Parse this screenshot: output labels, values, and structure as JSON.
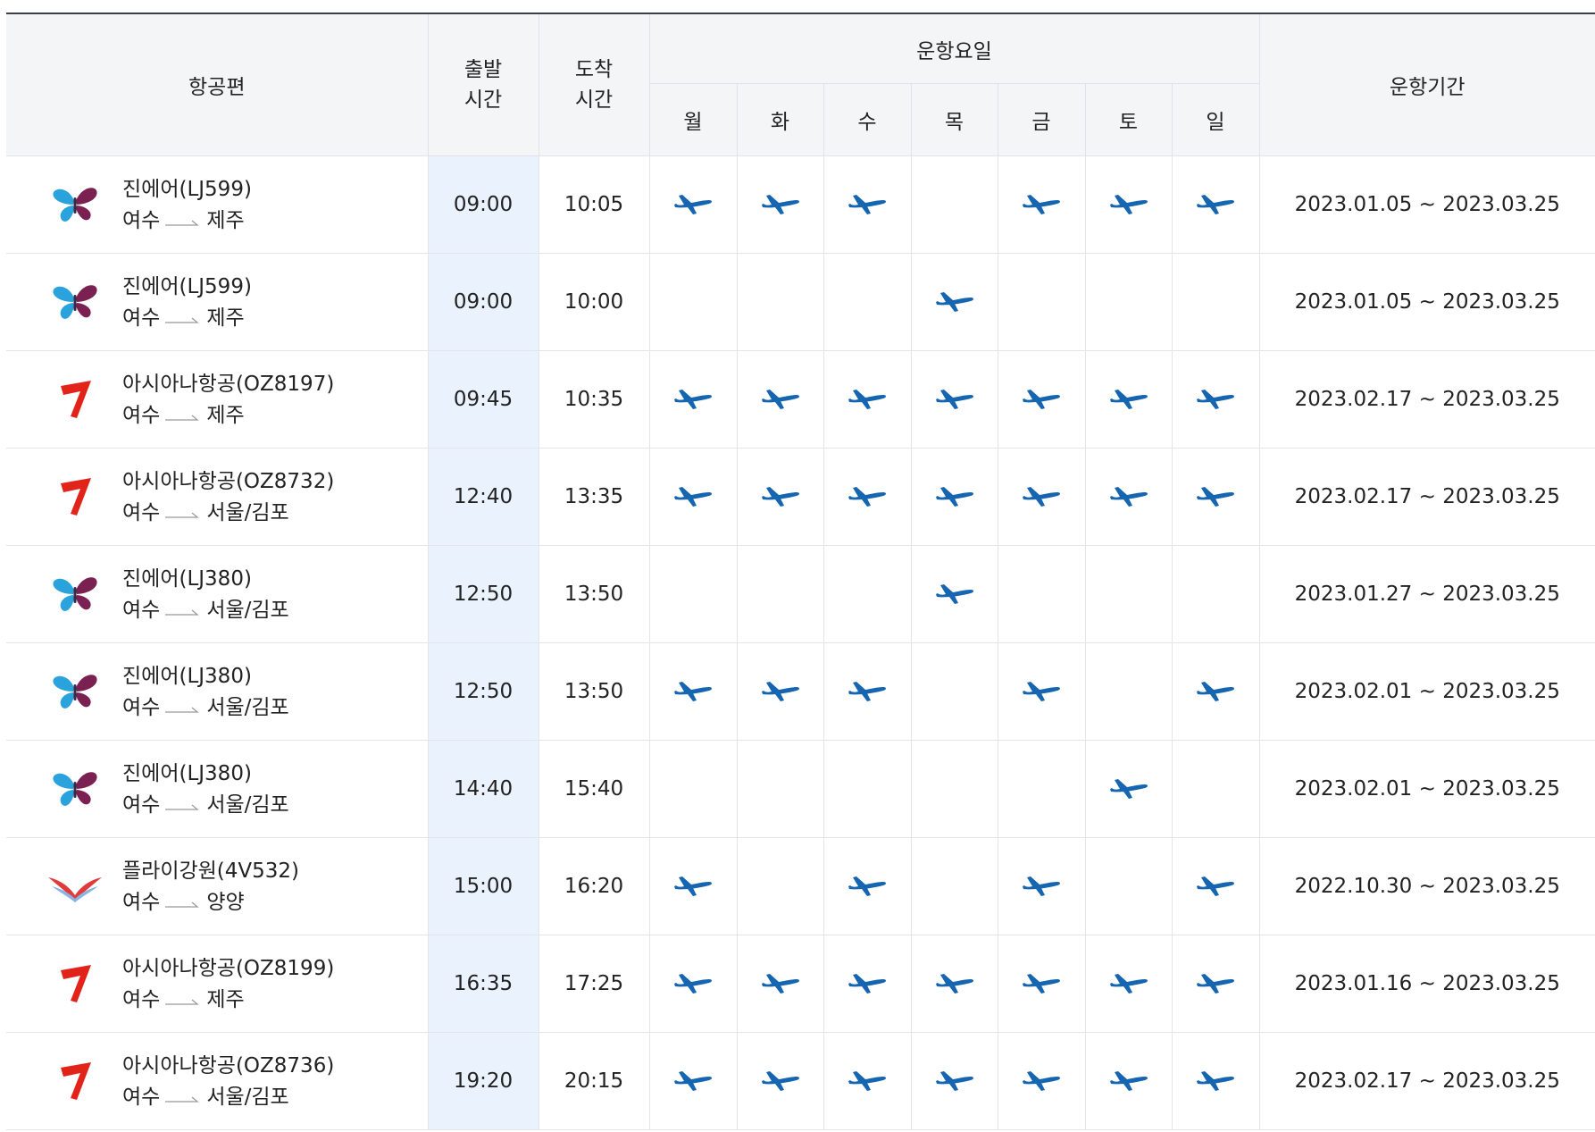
{
  "header": {
    "flight": "항공편",
    "departure": "출발\n시간",
    "departure_l1": "출발",
    "departure_l2": "시간",
    "arrival_l1": "도착",
    "arrival_l2": "시간",
    "operating_days": "운항요일",
    "days": [
      "월",
      "화",
      "수",
      "목",
      "금",
      "토",
      "일"
    ],
    "period": "운항기간"
  },
  "colors": {
    "header_bg": "#f4f5f7",
    "dep_col_bg": "#eaf3fd",
    "plane": "#1565b0",
    "asiana": "#e2231a",
    "jinair_blue": "#2aa3dc",
    "jinair_purple": "#7b2152"
  },
  "flights": [
    {
      "airline": "jinair",
      "name": "진에어(LJ599)",
      "origin": "여수",
      "dest": "제주",
      "dep": "09:00",
      "arr": "10:05",
      "days": [
        1,
        1,
        1,
        0,
        1,
        1,
        1
      ],
      "period": "2023.01.05 ~ 2023.03.25"
    },
    {
      "airline": "jinair",
      "name": "진에어(LJ599)",
      "origin": "여수",
      "dest": "제주",
      "dep": "09:00",
      "arr": "10:00",
      "days": [
        0,
        0,
        0,
        1,
        0,
        0,
        0
      ],
      "period": "2023.01.05 ~ 2023.03.25"
    },
    {
      "airline": "asiana",
      "name": "아시아나항공(OZ8197)",
      "origin": "여수",
      "dest": "제주",
      "dep": "09:45",
      "arr": "10:35",
      "days": [
        1,
        1,
        1,
        1,
        1,
        1,
        1
      ],
      "period": "2023.02.17 ~ 2023.03.25"
    },
    {
      "airline": "asiana",
      "name": "아시아나항공(OZ8732)",
      "origin": "여수",
      "dest": "서울/김포",
      "dep": "12:40",
      "arr": "13:35",
      "days": [
        1,
        1,
        1,
        1,
        1,
        1,
        1
      ],
      "period": "2023.02.17 ~ 2023.03.25"
    },
    {
      "airline": "jinair",
      "name": "진에어(LJ380)",
      "origin": "여수",
      "dest": "서울/김포",
      "dep": "12:50",
      "arr": "13:50",
      "days": [
        0,
        0,
        0,
        1,
        0,
        0,
        0
      ],
      "period": "2023.01.27 ~ 2023.03.25"
    },
    {
      "airline": "jinair",
      "name": "진에어(LJ380)",
      "origin": "여수",
      "dest": "서울/김포",
      "dep": "12:50",
      "arr": "13:50",
      "days": [
        1,
        1,
        1,
        0,
        1,
        0,
        1
      ],
      "period": "2023.02.01 ~ 2023.03.25"
    },
    {
      "airline": "jinair",
      "name": "진에어(LJ380)",
      "origin": "여수",
      "dest": "서울/김포",
      "dep": "14:40",
      "arr": "15:40",
      "days": [
        0,
        0,
        0,
        0,
        0,
        1,
        0
      ],
      "period": "2023.02.01 ~ 2023.03.25"
    },
    {
      "airline": "flygangwon",
      "name": "플라이강원(4V532)",
      "origin": "여수",
      "dest": "양양",
      "dep": "15:00",
      "arr": "16:20",
      "days": [
        1,
        0,
        1,
        0,
        1,
        0,
        1
      ],
      "period": "2022.10.30 ~ 2023.03.25"
    },
    {
      "airline": "asiana",
      "name": "아시아나항공(OZ8199)",
      "origin": "여수",
      "dest": "제주",
      "dep": "16:35",
      "arr": "17:25",
      "days": [
        1,
        1,
        1,
        1,
        1,
        1,
        1
      ],
      "period": "2023.01.16 ~ 2023.03.25"
    },
    {
      "airline": "asiana",
      "name": "아시아나항공(OZ8736)",
      "origin": "여수",
      "dest": "서울/김포",
      "dep": "19:20",
      "arr": "20:15",
      "days": [
        1,
        1,
        1,
        1,
        1,
        1,
        1
      ],
      "period": "2023.02.17 ~ 2023.03.25"
    }
  ]
}
